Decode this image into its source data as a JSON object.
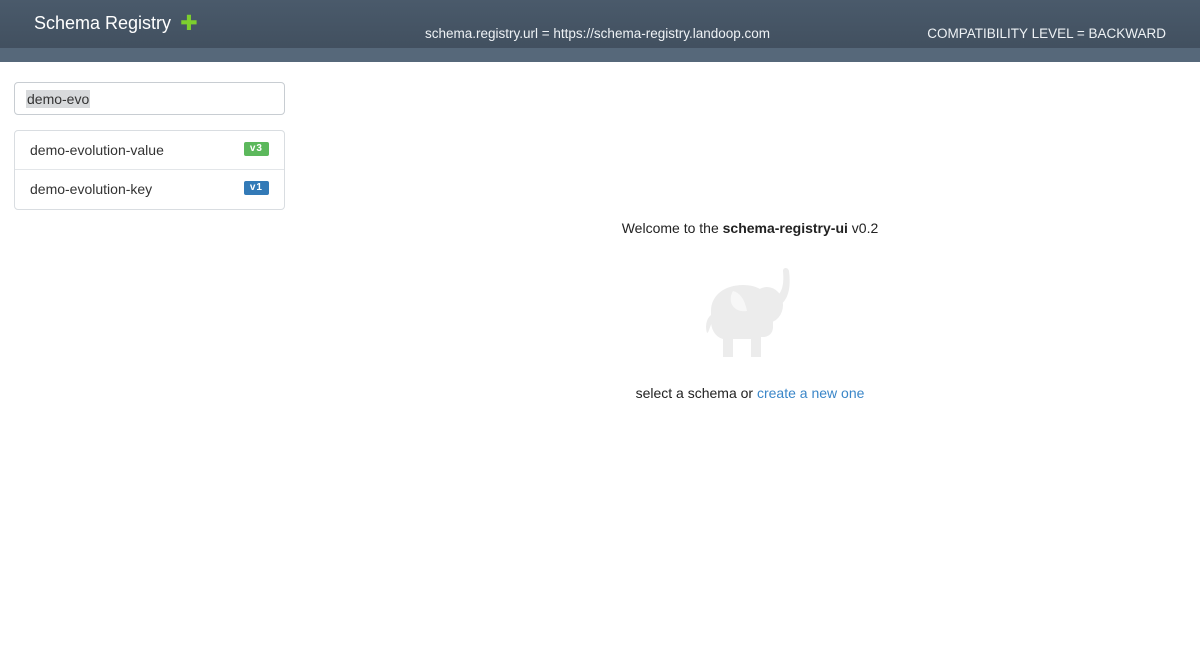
{
  "header": {
    "brand": "Schema Registry",
    "add_icon": "plus-icon",
    "registry_url": "schema.registry.url = https://schema-registry.landoop.com",
    "compatibility": "COMPATIBILITY LEVEL = BACKWARD",
    "background_color": "#455667",
    "add_icon_color": "#7dcf2e"
  },
  "sidebar": {
    "search": {
      "value": "demo-evo",
      "placeholder": ""
    },
    "items": [
      {
        "label": "demo-evolution-value",
        "version": "v3",
        "badge_color": "#5cb85c"
      },
      {
        "label": "demo-evolution-key",
        "version": "v1",
        "badge_color": "#337ab7"
      }
    ]
  },
  "main": {
    "welcome_prefix": "Welcome to the ",
    "app_name": "schema-registry-ui",
    "version": " v0.2",
    "logo_icon": "elephant-icon",
    "select_text": "select a schema or ",
    "create_link": "create a new one",
    "link_color": "#3a86c8"
  }
}
